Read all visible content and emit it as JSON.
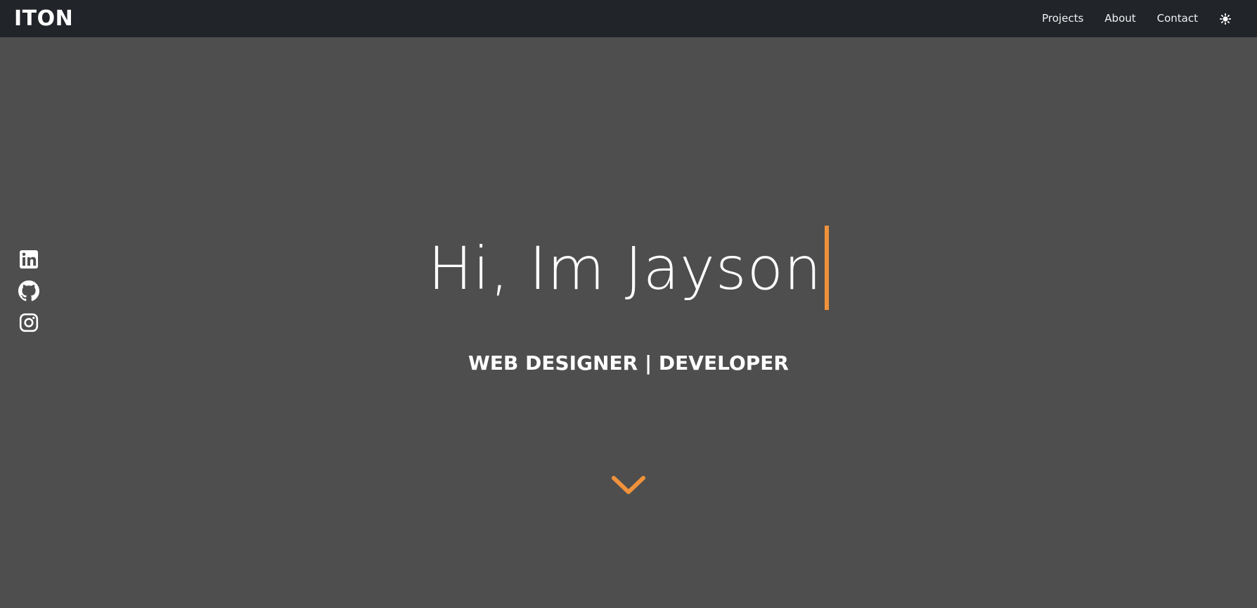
{
  "navbar": {
    "brand": "ITON",
    "links": [
      {
        "label": "Projects"
      },
      {
        "label": "About"
      },
      {
        "label": "Contact"
      }
    ],
    "theme_toggle_icon": "sun-icon"
  },
  "social": [
    {
      "icon": "linkedin-icon"
    },
    {
      "icon": "github-icon"
    },
    {
      "icon": "instagram-icon"
    }
  ],
  "hero": {
    "greeting": "Hi, Im Jayson",
    "subtitle": "WEB DESIGNER | DEVELOPER",
    "scroll_icon": "chevron-down-icon"
  },
  "colors": {
    "navbar_bg": "#212429",
    "page_bg": "#4e4e4e",
    "accent": "#f0923b",
    "text": "#ffffff"
  }
}
